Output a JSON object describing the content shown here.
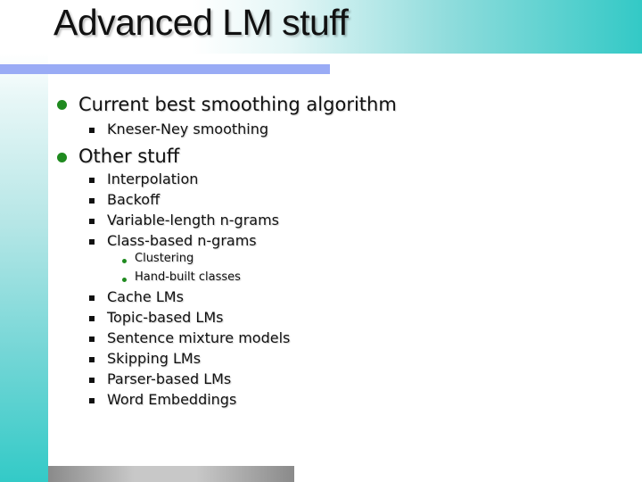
{
  "slide": {
    "title": "Advanced LM stuff",
    "colors": {
      "header_teal": "#33c9c6",
      "accent_bar": "#99abf5",
      "bullet_green": "#1f8a1f"
    },
    "bullets": [
      {
        "text": "Current best smoothing algorithm",
        "children": [
          {
            "text": "Kneser-Ney smoothing"
          }
        ]
      },
      {
        "text": "Other stuff",
        "children": [
          {
            "text": "Interpolation"
          },
          {
            "text": "Backoff"
          },
          {
            "text": "Variable-length n-grams"
          },
          {
            "text": "Class-based n-grams",
            "children": [
              {
                "text": "Clustering"
              },
              {
                "text": "Hand-built classes"
              }
            ]
          },
          {
            "text": "Cache LMs"
          },
          {
            "text": "Topic-based LMs"
          },
          {
            "text": "Sentence mixture models"
          },
          {
            "text": "Skipping LMs"
          },
          {
            "text": "Parser-based LMs"
          },
          {
            "text": "Word Embeddings"
          }
        ]
      }
    ]
  }
}
